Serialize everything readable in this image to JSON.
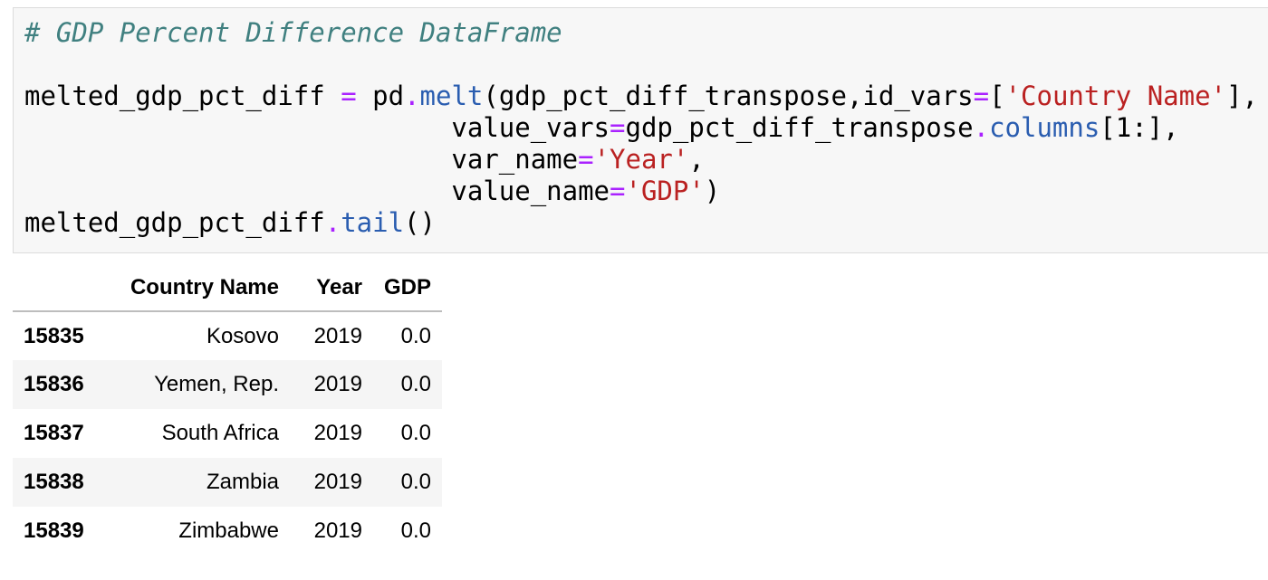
{
  "input_cell": {
    "lines": [
      [
        {
          "t": "# GDP Percent Difference DataFrame",
          "c": "comment"
        }
      ],
      [],
      [
        {
          "t": "melted_gdp_pct_diff "
        },
        {
          "t": "=",
          "c": "op"
        },
        {
          "t": " pd"
        },
        {
          "t": ".",
          "c": "op"
        },
        {
          "t": "melt",
          "c": "attr"
        },
        {
          "t": "(gdp_pct_diff_transpose,id_vars"
        },
        {
          "t": "=",
          "c": "op"
        },
        {
          "t": "["
        },
        {
          "t": "'Country Name'",
          "c": "str"
        },
        {
          "t": "],"
        }
      ],
      [
        {
          "t": "                           value_vars"
        },
        {
          "t": "=",
          "c": "op"
        },
        {
          "t": "gdp_pct_diff_transpose"
        },
        {
          "t": ".",
          "c": "op"
        },
        {
          "t": "columns",
          "c": "attr"
        },
        {
          "t": "[1:],"
        }
      ],
      [
        {
          "t": "                           var_name"
        },
        {
          "t": "=",
          "c": "op"
        },
        {
          "t": "'Year'",
          "c": "str"
        },
        {
          "t": ","
        }
      ],
      [
        {
          "t": "                           value_name"
        },
        {
          "t": "=",
          "c": "op"
        },
        {
          "t": "'GDP'",
          "c": "str"
        },
        {
          "t": ")"
        }
      ],
      [
        {
          "t": "melted_gdp_pct_diff"
        },
        {
          "t": ".",
          "c": "op"
        },
        {
          "t": "tail",
          "c": "attr"
        },
        {
          "t": "()"
        }
      ]
    ]
  },
  "output_table": {
    "columns": [
      "",
      "Country Name",
      "Year",
      "GDP"
    ],
    "rows": [
      {
        "index": "15835",
        "country": "Kosovo",
        "year": "2019",
        "gdp": "0.0"
      },
      {
        "index": "15836",
        "country": "Yemen, Rep.",
        "year": "2019",
        "gdp": "0.0"
      },
      {
        "index": "15837",
        "country": "South Africa",
        "year": "2019",
        "gdp": "0.0"
      },
      {
        "index": "15838",
        "country": "Zambia",
        "year": "2019",
        "gdp": "0.0"
      },
      {
        "index": "15839",
        "country": "Zimbabwe",
        "year": "2019",
        "gdp": "0.0"
      }
    ]
  }
}
